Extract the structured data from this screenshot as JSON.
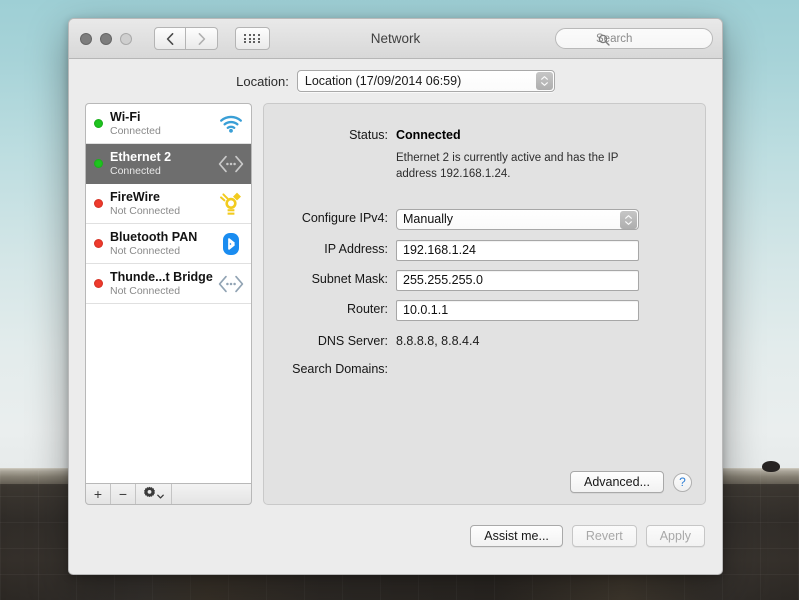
{
  "window": {
    "title": "Network",
    "traffic_lights": [
      "close",
      "minimize",
      "zoom"
    ],
    "nav_back": "back-icon",
    "nav_forward": "forward-icon",
    "grid_button": "show-all-icon"
  },
  "search": {
    "placeholder": "Search",
    "icon": "search-icon",
    "value": ""
  },
  "location": {
    "label": "Location:",
    "value": "Location (17/09/2014 06:59)"
  },
  "sidebar": {
    "interfaces": [
      {
        "name": "Wi-Fi",
        "status": "Connected",
        "dot": "green",
        "icon": "wifi-icon",
        "selected": false
      },
      {
        "name": "Ethernet 2",
        "status": "Connected",
        "dot": "green",
        "icon": "ethernet-icon",
        "selected": true
      },
      {
        "name": "FireWire",
        "status": "Not Connected",
        "dot": "red",
        "icon": "firewire-icon",
        "selected": false
      },
      {
        "name": "Bluetooth PAN",
        "status": "Not Connected",
        "dot": "red",
        "icon": "bluetooth-icon",
        "selected": false
      },
      {
        "name": "Thunde...t Bridge",
        "status": "Not Connected",
        "dot": "red",
        "icon": "thunderbolt-bridge-icon",
        "selected": false
      }
    ],
    "toolbar": {
      "add_label": "+",
      "remove_label": "−",
      "actions_icon": "gear-icon",
      "actions_chevron": "chevron-down-icon"
    }
  },
  "detail": {
    "status_label": "Status:",
    "status_value": "Connected",
    "status_description": "Ethernet 2 is currently active and has the IP address 192.168.1.24.",
    "configure_label": "Configure IPv4:",
    "configure_value": "Manually",
    "ip_label": "IP Address:",
    "ip_value": "192.168.1.24",
    "subnet_label": "Subnet Mask:",
    "subnet_value": "255.255.255.0",
    "router_label": "Router:",
    "router_value": "10.0.1.1",
    "dns_label": "DNS Server:",
    "dns_value": "8.8.8.8, 8.8.4.4",
    "search_domains_label": "Search Domains:",
    "search_domains_value": "",
    "advanced_label": "Advanced...",
    "help_label": "?"
  },
  "footer": {
    "assist_label": "Assist me...",
    "revert_label": "Revert",
    "apply_label": "Apply"
  },
  "colors": {
    "accent_blue": "#2d7fd6",
    "connected_green": "#1fc51f",
    "disconnected_red": "#f03b2d",
    "selection_gray": "#6e6e6e",
    "bluetooth_blue": "#1a8cf0",
    "firewire_gold": "#f2cb1e"
  }
}
